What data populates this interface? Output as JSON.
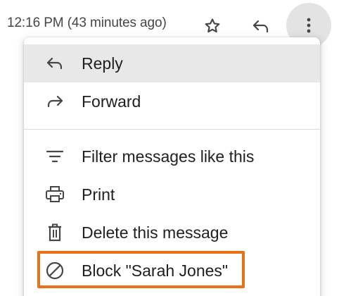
{
  "header": {
    "timestamp": "12:16 PM (43 minutes ago)",
    "star_icon": "star-outline-icon",
    "reply_icon": "reply-icon",
    "more_icon": "more-vertical-icon"
  },
  "menu": {
    "items": [
      {
        "label": "Reply",
        "icon": "reply-icon",
        "hovered": true
      },
      {
        "label": "Forward",
        "icon": "forward-icon"
      },
      {
        "label": "Filter messages like this",
        "icon": "filter-icon"
      },
      {
        "label": "Print",
        "icon": "printer-icon"
      },
      {
        "label": "Delete this message",
        "icon": "trash-icon"
      },
      {
        "label": "Block \"Sarah Jones\"",
        "icon": "block-icon",
        "highlighted": true
      }
    ]
  },
  "colors": {
    "highlight": "#e8711a",
    "hover_bg": "#e8e8e8",
    "more_button_bg": "#e3e3e3"
  }
}
